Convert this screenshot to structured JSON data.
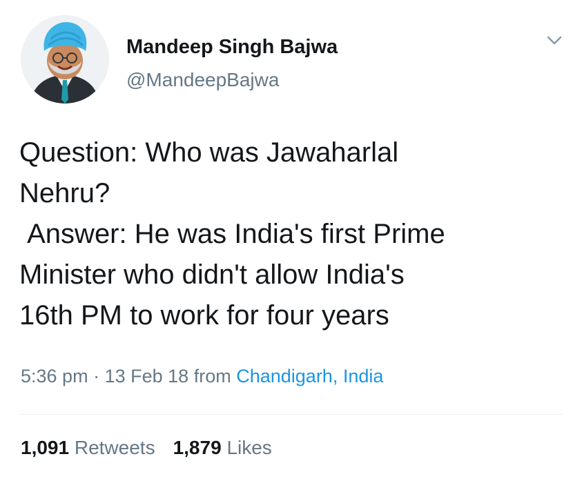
{
  "author": {
    "display_name": "Mandeep Singh Bajwa",
    "handle": "@MandeepBajwa"
  },
  "tweet": {
    "text": "Question: Who was Jawaharlal\nNehru?\n Answer: He was India's first Prime\nMinister who didn't allow India's\n16th PM to work for four years"
  },
  "meta": {
    "time": "5:36 pm",
    "separator": "·",
    "date": "13 Feb 18",
    "from_label": "from",
    "place": "Chandigarh, India"
  },
  "stats": {
    "retweets_count": "1,091",
    "retweets_label": "Retweets",
    "likes_count": "1,879",
    "likes_label": "Likes"
  },
  "icons": {
    "menu": "chevron-down-icon"
  },
  "colors": {
    "text": "#14171a",
    "secondary": "#657786",
    "link": "#1b95e0",
    "turban": "#3fb4e6"
  }
}
